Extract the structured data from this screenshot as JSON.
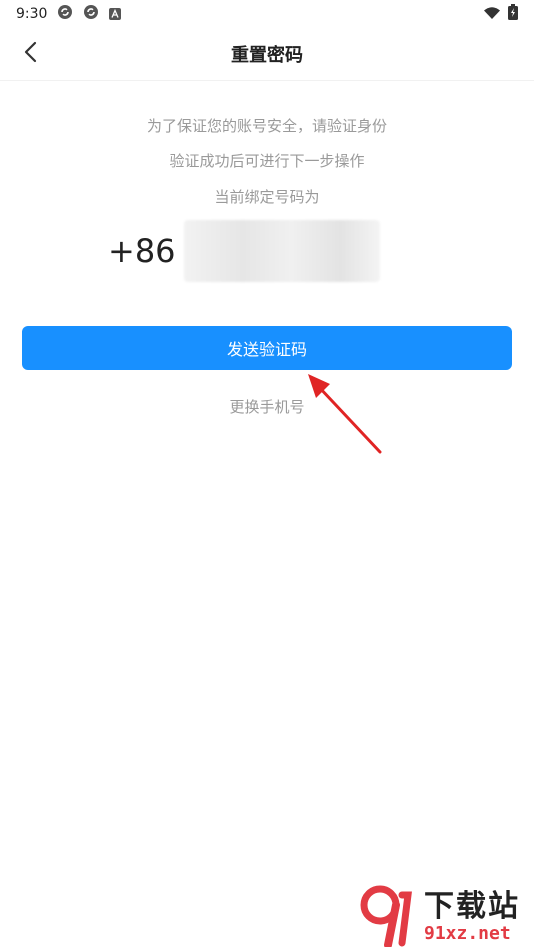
{
  "status_bar": {
    "time": "9:30",
    "icons_left": [
      "sync-icon",
      "sync-icon",
      "a-icon"
    ],
    "icons_right": [
      "wifi-icon",
      "battery-charging-icon"
    ]
  },
  "nav": {
    "back_icon": "chevron-left-icon",
    "title": "重置密码"
  },
  "content": {
    "hint_line1": "为了保证您的账号安全，请验证身份",
    "hint_line2": "验证成功后可进行下一步操作",
    "hint_line3": "当前绑定号码为",
    "phone_prefix": "+86",
    "send_button": "发送验证码",
    "change_phone": "更换手机号"
  },
  "watermark": {
    "title": "下载站",
    "subtitle": "91xz.net"
  },
  "colors": {
    "primary": "#1890ff",
    "hint_text": "#9a9a9a",
    "arrow": "#e02424",
    "watermark_red": "#e23b44"
  }
}
